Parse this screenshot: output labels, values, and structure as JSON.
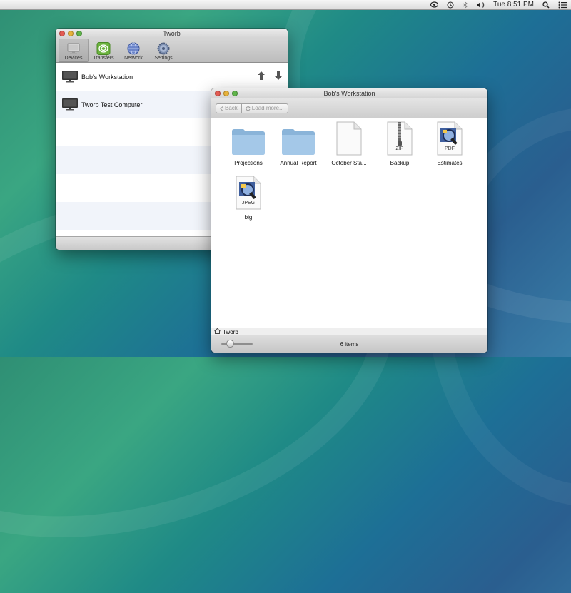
{
  "menubar": {
    "clock": "Tue 8:51 PM",
    "icons": [
      "tworb-icon",
      "time-machine-icon",
      "bluetooth-icon",
      "volume-icon",
      "spotlight-icon",
      "notification-center-icon"
    ]
  },
  "tworb_window": {
    "title": "Tworb",
    "toolbar": {
      "devices": "Devices",
      "transfers": "Transfers",
      "network": "Network",
      "settings": "Settings"
    },
    "devices": [
      {
        "name": "Bob's Workstation"
      },
      {
        "name": "Tworb Test Computer"
      }
    ]
  },
  "finder_window": {
    "title": "Bob's Workstation",
    "back_label": "Back",
    "load_more_label": "Load more...",
    "files": [
      {
        "name": "Projections",
        "type": "folder"
      },
      {
        "name": "Annual Report",
        "type": "folder"
      },
      {
        "name": "October Sta...",
        "type": "document"
      },
      {
        "name": "Backup",
        "type": "zip",
        "badge": "ZIP"
      },
      {
        "name": "Estimates",
        "type": "pdf",
        "badge": "PDF"
      },
      {
        "name": "big",
        "type": "jpeg",
        "badge": "JPEG"
      }
    ],
    "path": "Tworb",
    "item_count": "6 items"
  }
}
